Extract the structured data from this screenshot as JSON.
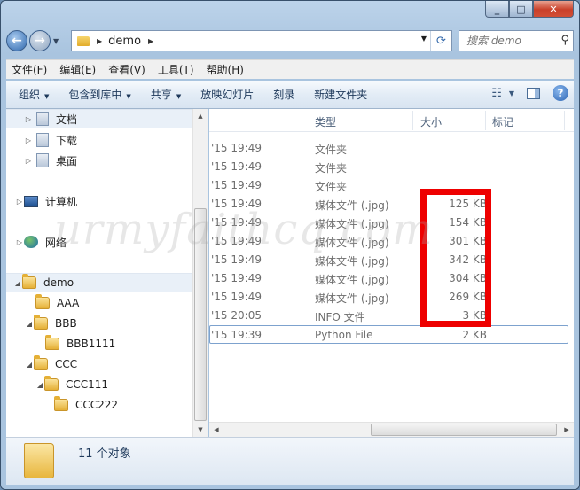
{
  "address": {
    "path": "demo"
  },
  "search": {
    "placeholder": "搜索 demo"
  },
  "menu": [
    "文件(F)",
    "编辑(E)",
    "查看(V)",
    "工具(T)",
    "帮助(H)"
  ],
  "toolbar": {
    "organize": "组织",
    "include_in_library": "包含到库中",
    "share": "共享",
    "slideshow": "放映幻灯片",
    "burn": "刻录",
    "new_folder": "新建文件夹"
  },
  "tree": {
    "documents": "文档",
    "downloads": "下载",
    "desktop": "桌面",
    "computer": "计算机",
    "network": "网络",
    "demo": "demo",
    "aaa": "AAA",
    "bbb": "BBB",
    "bbb1111": "BBB1111",
    "ccc": "CCC",
    "ccc111": "CCC111",
    "ccc222": "CCC222"
  },
  "columns": {
    "type": "类型",
    "size": "大小",
    "tags": "标记"
  },
  "files": [
    {
      "date": "'15 19:49",
      "type": "文件夹",
      "size": ""
    },
    {
      "date": "'15 19:49",
      "type": "文件夹",
      "size": ""
    },
    {
      "date": "'15 19:49",
      "type": "文件夹",
      "size": ""
    },
    {
      "date": "'15 19:49",
      "type": "媒体文件 (.jpg)",
      "size": "125 KB"
    },
    {
      "date": "'15 19:49",
      "type": "媒体文件 (.jpg)",
      "size": "154 KB"
    },
    {
      "date": "'15 19:49",
      "type": "媒体文件 (.jpg)",
      "size": "301 KB"
    },
    {
      "date": "'15 19:49",
      "type": "媒体文件 (.jpg)",
      "size": "342 KB"
    },
    {
      "date": "'15 19:49",
      "type": "媒体文件 (.jpg)",
      "size": "304 KB"
    },
    {
      "date": "'15 19:49",
      "type": "媒体文件 (.jpg)",
      "size": "269 KB"
    },
    {
      "date": "'15 20:05",
      "type": "INFO 文件",
      "size": "3 KB"
    },
    {
      "date": "'15 19:39",
      "type": "Python File",
      "size": "2 KB"
    }
  ],
  "status": {
    "count": "11 个对象"
  },
  "watermark": "urmyfaithcq.com",
  "colors": {
    "highlight": "#ee0000",
    "selection": "#e9f0f8"
  }
}
